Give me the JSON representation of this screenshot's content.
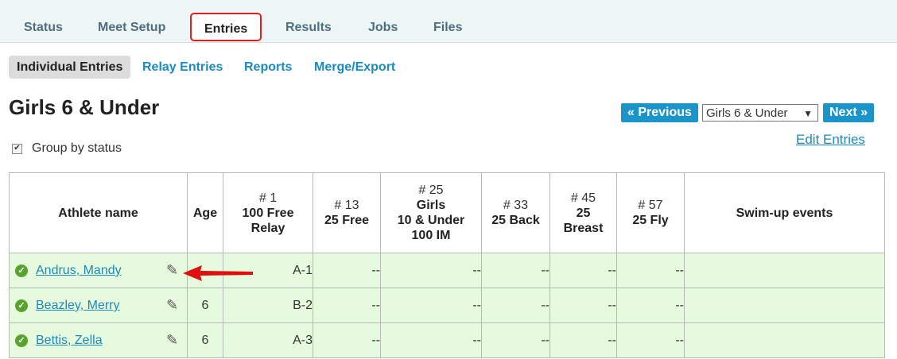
{
  "top_tabs": [
    "Status",
    "Meet Setup",
    "Entries",
    "Results",
    "Jobs",
    "Files"
  ],
  "sub_tabs": [
    "Individual Entries",
    "Relay Entries",
    "Reports",
    "Merge/Export"
  ],
  "page_title": "Girls 6 & Under",
  "group_by": {
    "label": "Group by status",
    "checked": true,
    "mark": "✔"
  },
  "nav": {
    "previous": "« Previous",
    "select_value": "Girls 6 & Under",
    "select_arrow": "▼",
    "next": "Next »",
    "edit": "Edit Entries"
  },
  "table": {
    "headers": {
      "athlete": "Athlete name",
      "age": "Age",
      "events": [
        {
          "num": "# 1",
          "lines": [
            "100 Free",
            "Relay"
          ]
        },
        {
          "num": "# 13",
          "lines": [
            "25 Free"
          ]
        },
        {
          "num": "# 25",
          "lines": [
            "Girls",
            "10 & Under",
            "100 IM"
          ]
        },
        {
          "num": "# 33",
          "lines": [
            "25 Back"
          ]
        },
        {
          "num": "# 45",
          "lines": [
            "25",
            "Breast"
          ]
        },
        {
          "num": "# 57",
          "lines": [
            "25 Fly"
          ]
        }
      ],
      "swimup": "Swim-up events"
    },
    "rows": [
      {
        "name": "Andrus, Mandy",
        "age": "",
        "cells": [
          "A-1",
          "--",
          "--",
          "--",
          "--",
          "--"
        ]
      },
      {
        "name": "Beazley, Merry",
        "age": "6",
        "cells": [
          "B-2",
          "--",
          "--",
          "--",
          "--",
          "--"
        ]
      },
      {
        "name": "Bettis, Zella",
        "age": "6",
        "cells": [
          "A-3",
          "--",
          "--",
          "--",
          "--",
          "--"
        ]
      }
    ],
    "entered_columns": [
      0,
      1,
      3
    ]
  },
  "icons": {
    "status": "check-circle-icon",
    "edit": "pencil-icon",
    "pointer": "red-arrow-icon"
  },
  "colors": {
    "accent": "#1b94c9",
    "entered_green": "#4f8f1c",
    "row_bg": "#e6fadd",
    "athlete_header": "#7fd3f9",
    "highlight": "#e02020"
  }
}
